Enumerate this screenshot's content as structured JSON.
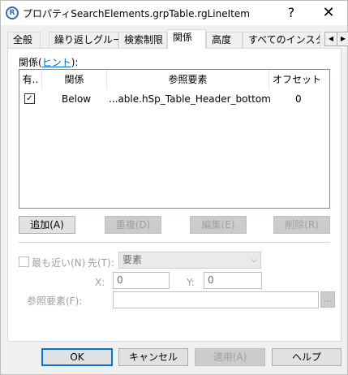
{
  "window": {
    "title": "プロパティSearchElements.grpTable.rgLineItem",
    "help_glyph": "?",
    "close_glyph": "✕"
  },
  "tabs": [
    {
      "label": "全般"
    },
    {
      "label": "繰り返しグループ"
    },
    {
      "label": "検索制限"
    },
    {
      "label": "関係"
    },
    {
      "label": "高度"
    },
    {
      "label": "すべてのインスタ"
    }
  ],
  "tab_scroll": {
    "left": "◀",
    "right": "▶"
  },
  "relation": {
    "label_prefix": "関係(",
    "label_link": "ヒント",
    "label_suffix": "):",
    "columns": [
      "有..",
      "関係",
      "参照要素",
      "オフセット"
    ],
    "rows": [
      {
        "enabled": "✓",
        "relation": "Below",
        "reference": "...able.hSp_Table_Header_bottom.Top",
        "offset": "0"
      }
    ],
    "buttons": {
      "add": "追加(A)",
      "duplicate": "重複(D)",
      "edit": "編集(E)",
      "delete": "削除(R)"
    }
  },
  "details": {
    "nearest_label": "最も近い(N)",
    "target_label": "先(T):",
    "target_value": "要素",
    "x_label": "X:",
    "x_value": "0",
    "y_label": "Y:",
    "y_value": "0",
    "ref_label": "参照要素(F):",
    "ref_value": "",
    "browse": "..."
  },
  "footer": {
    "ok": "OK",
    "cancel": "キャンセル",
    "apply": "適用(A)",
    "help": "ヘルプ"
  }
}
